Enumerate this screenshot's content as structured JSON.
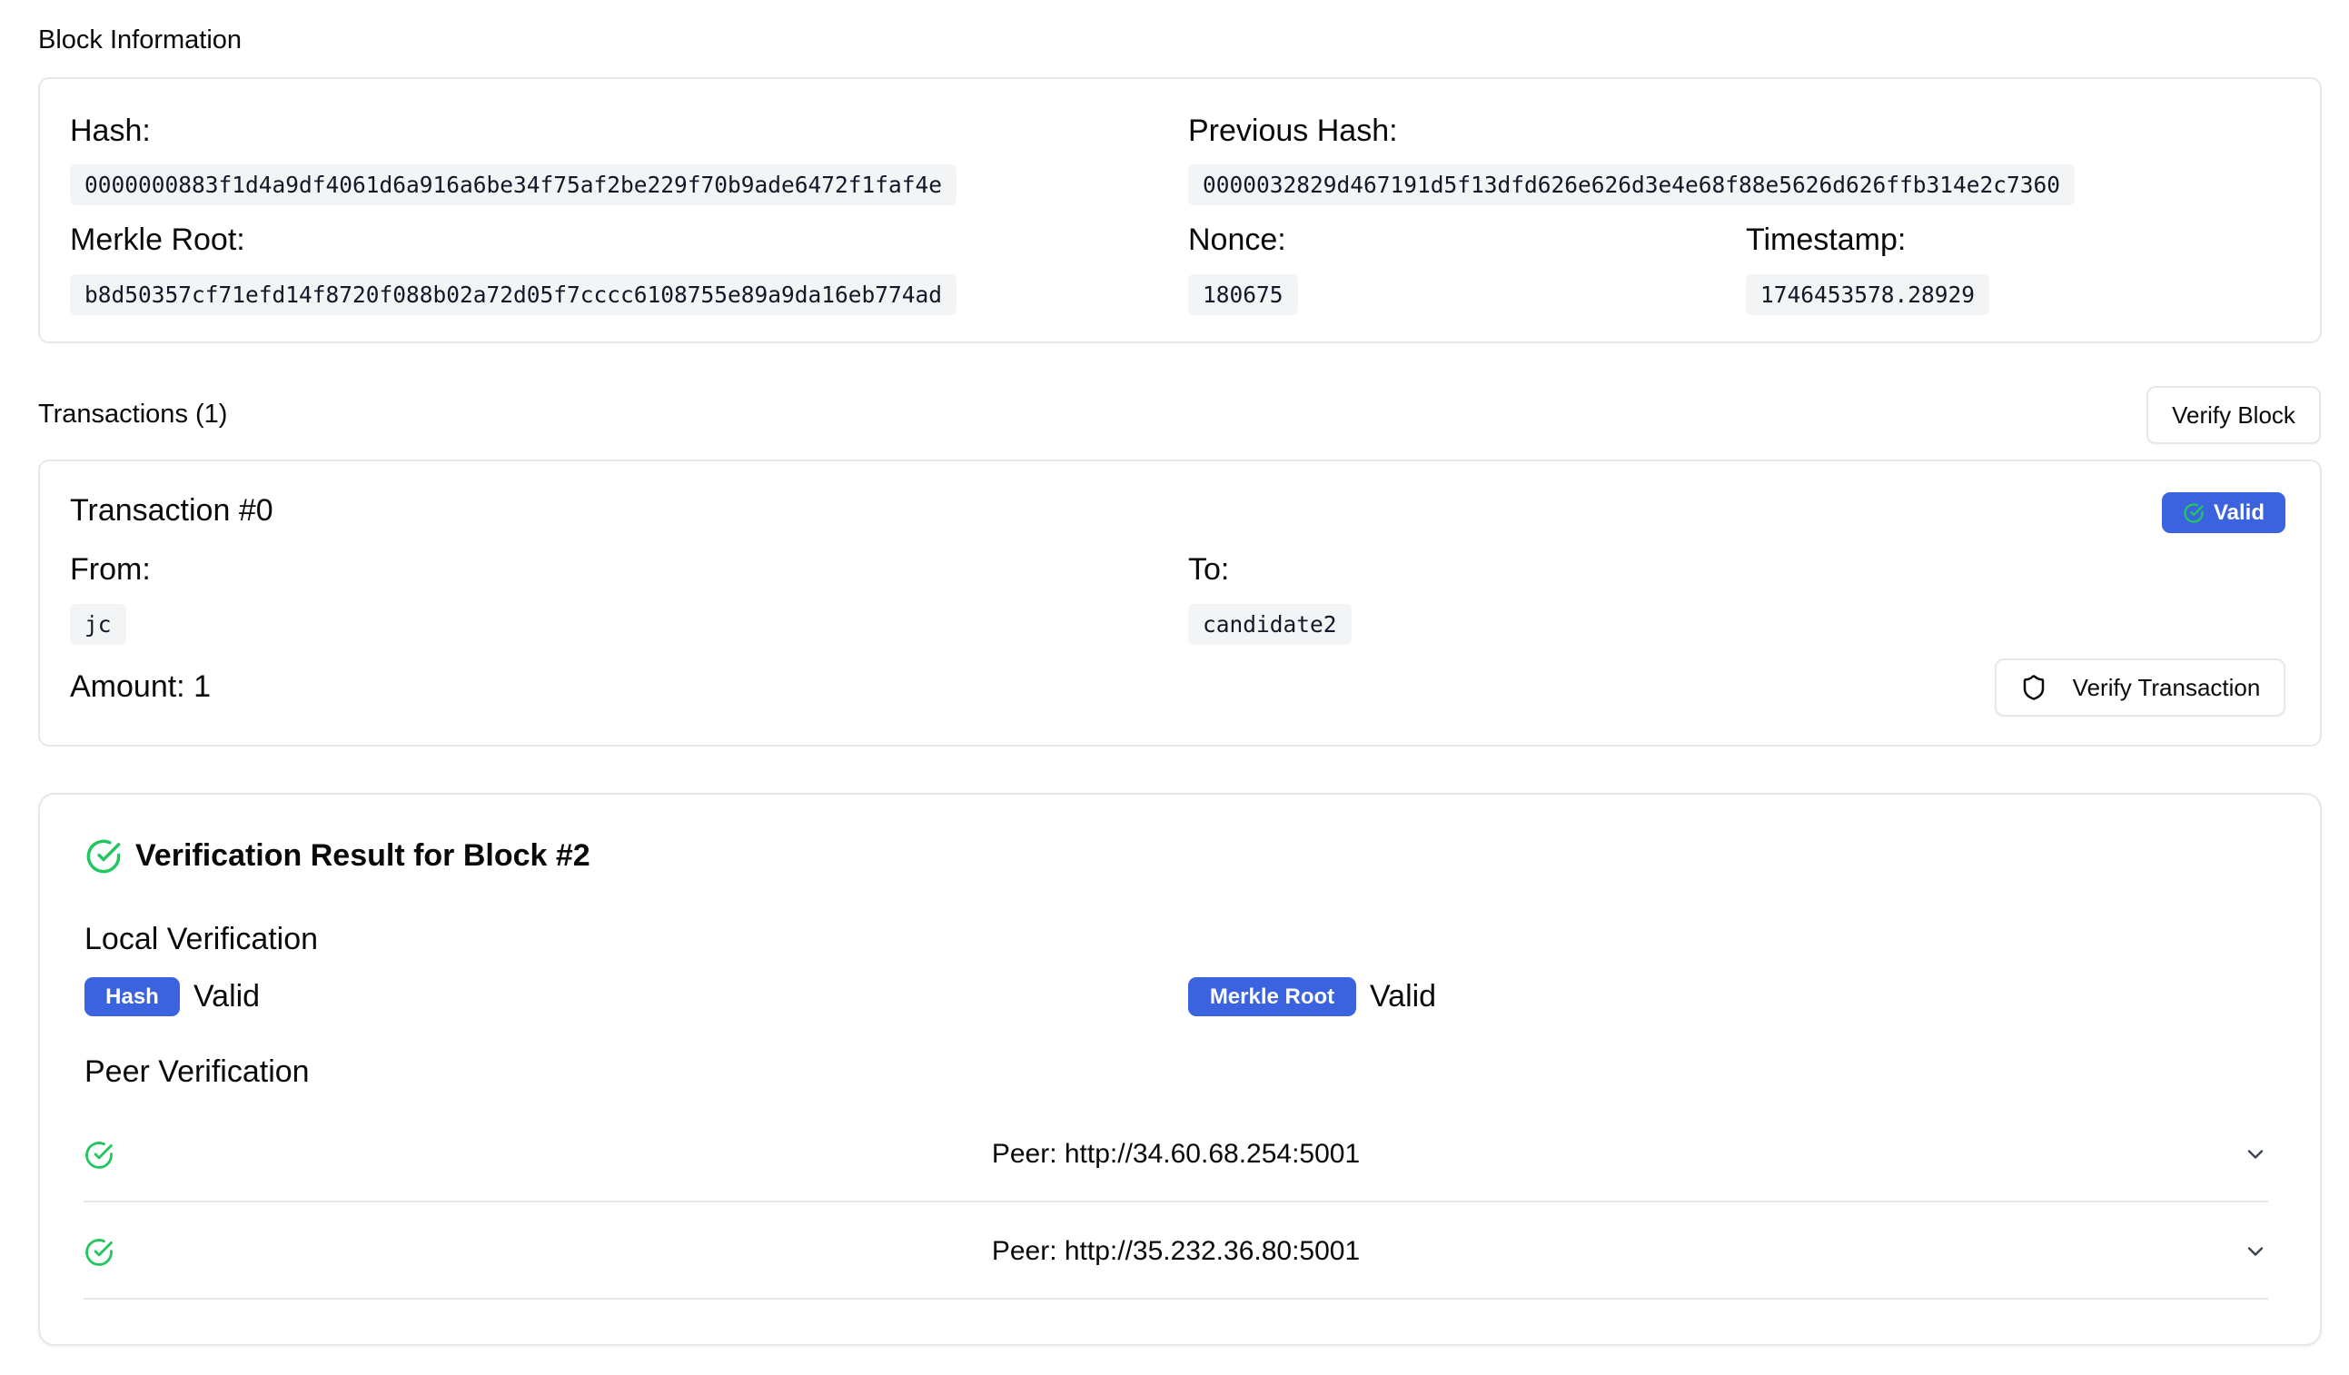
{
  "block_info": {
    "title": "Block Information",
    "hash_label": "Hash:",
    "hash": "0000000883f1d4a9df4061d6a916a6be34f75af2be229f70b9ade6472f1faf4e",
    "prev_hash_label": "Previous Hash:",
    "prev_hash": "0000032829d467191d5f13dfd626e626d3e4e68f88e5626d626ffb314e2c7360",
    "merkle_label": "Merkle Root:",
    "merkle_root": "b8d50357cf71efd14f8720f088b02a72d05f7cccc6108755e89a9da16eb774ad",
    "nonce_label": "Nonce:",
    "nonce": "180675",
    "timestamp_label": "Timestamp:",
    "timestamp": "1746453578.28929"
  },
  "transactions": {
    "title": "Transactions (1)",
    "verify_block_label": "Verify Block",
    "items": [
      {
        "title": "Transaction #0",
        "status": "Valid",
        "from_label": "From:",
        "from": "jc",
        "to_label": "To:",
        "to": "candidate2",
        "amount_label": "Amount: 1",
        "verify_label": "Verify Transaction"
      }
    ]
  },
  "verification": {
    "title": "Verification Result for Block #2",
    "local_title": "Local Verification",
    "hash_badge": "Hash",
    "hash_status": "Valid",
    "merkle_badge": "Merkle Root",
    "merkle_status": "Valid",
    "peer_title": "Peer Verification",
    "peers": [
      {
        "label": "Peer: http://34.60.68.254:5001"
      },
      {
        "label": "Peer: http://35.232.36.80:5001"
      }
    ]
  },
  "colors": {
    "accent": "#3b63e0",
    "success": "#22c55e",
    "border": "#e5e7eb",
    "code_bg": "#f3f4f6"
  },
  "icons": {
    "valid_badge": "check-circle-icon",
    "verify_transaction": "shield-icon",
    "verification_title": "check-circle-icon",
    "peer_status": "check-circle-icon",
    "peer_expand": "chevron-down-icon"
  }
}
